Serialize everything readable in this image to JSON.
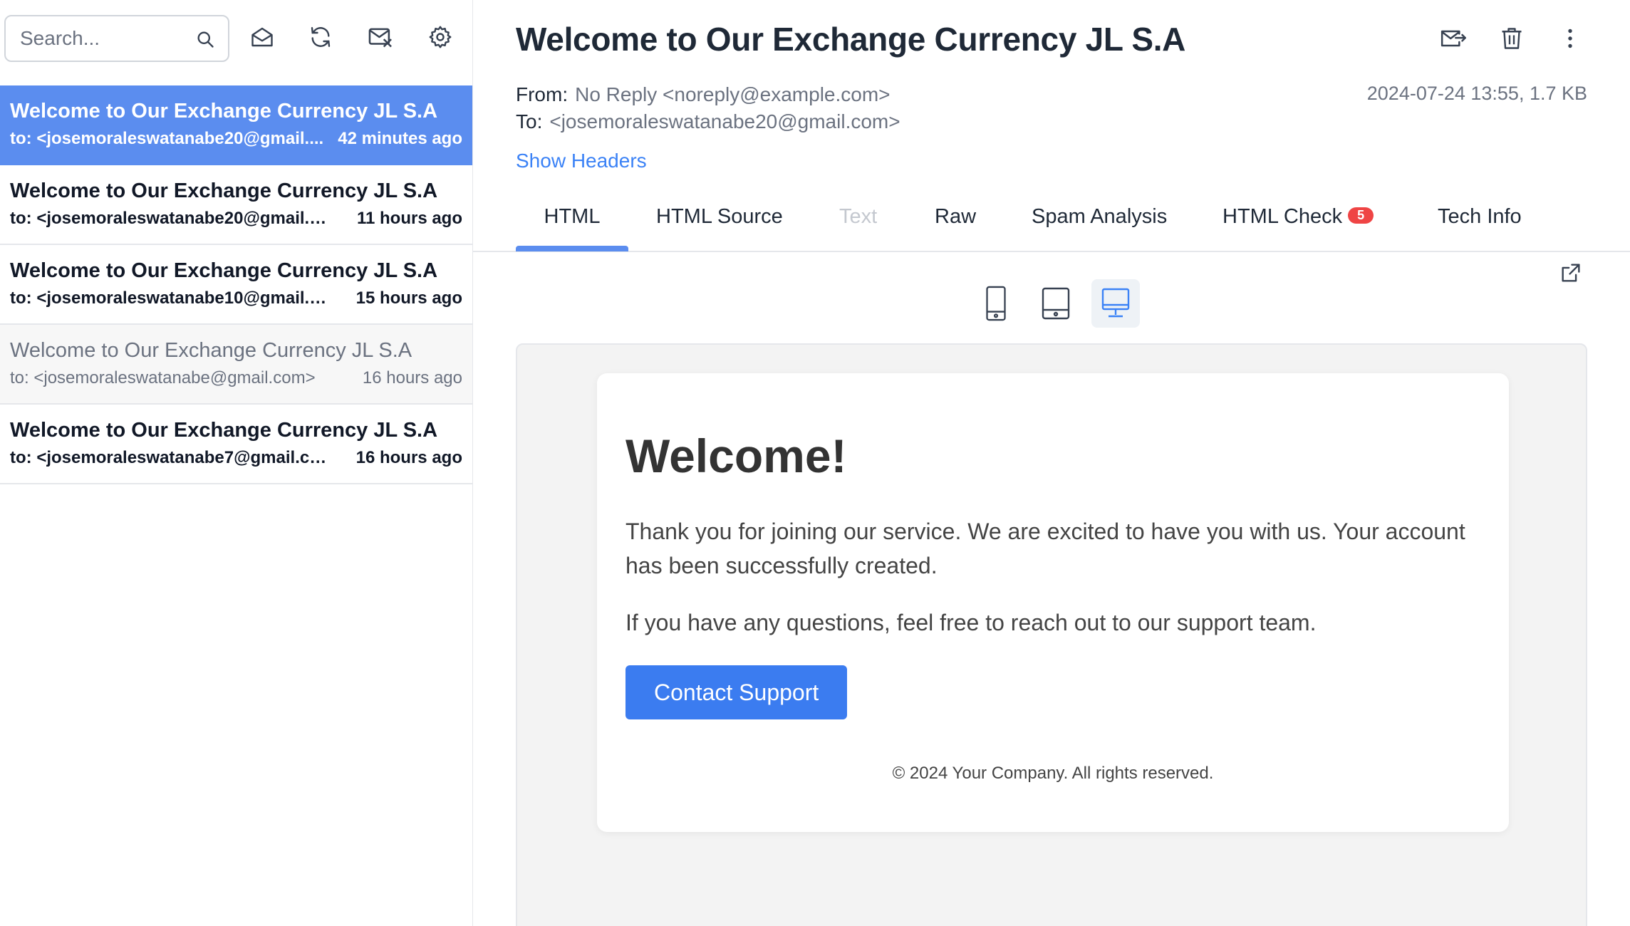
{
  "toolbar": {
    "search_placeholder": "Search..."
  },
  "messages": [
    {
      "subject": "Welcome to Our Exchange Currency JL S.A",
      "to": "to: <josemoraleswatanabe20@gmail....",
      "time": "42 minutes ago",
      "state": "active"
    },
    {
      "subject": "Welcome to Our Exchange Currency JL S.A",
      "to": "to: <josemoraleswatanabe20@gmail.co...",
      "time": "11 hours ago",
      "state": "unread"
    },
    {
      "subject": "Welcome to Our Exchange Currency JL S.A",
      "to": "to: <josemoraleswatanabe10@gmail.co...",
      "time": "15 hours ago",
      "state": "unread"
    },
    {
      "subject": "Welcome to Our Exchange Currency JL S.A",
      "to": "to: <josemoraleswatanabe@gmail.com>",
      "time": "16 hours ago",
      "state": "read"
    },
    {
      "subject": "Welcome to Our Exchange Currency JL S.A",
      "to": "to: <josemoraleswatanabe7@gmail.com>",
      "time": "16 hours ago",
      "state": "unread"
    }
  ],
  "email": {
    "title": "Welcome to Our Exchange Currency JL S.A",
    "from_label": "From:",
    "from_value": "No Reply <noreply@example.com>",
    "to_label": "To:",
    "to_value": "<josemoraleswatanabe20@gmail.com>",
    "date_size": "2024-07-24 13:55, 1.7 KB",
    "show_headers": "Show Headers"
  },
  "tabs": [
    {
      "label": "HTML",
      "state": "active"
    },
    {
      "label": "HTML Source",
      "state": "normal"
    },
    {
      "label": "Text",
      "state": "disabled"
    },
    {
      "label": "Raw",
      "state": "normal"
    },
    {
      "label": "Spam Analysis",
      "state": "normal"
    },
    {
      "label": "HTML Check",
      "state": "normal",
      "badge": "5"
    },
    {
      "label": "Tech Info",
      "state": "normal"
    }
  ],
  "preview": {
    "heading": "Welcome!",
    "paragraph1": "Thank you for joining our service. We are excited to have you with us. Your account has been successfully created.",
    "paragraph2": "If you have any questions, feel free to reach out to our support team.",
    "button": "Contact Support",
    "footer": "© 2024 Your Company. All rights reserved."
  },
  "colors": {
    "accent": "#5b8def",
    "link": "#3b82f6",
    "badge": "#ef4444",
    "button": "#3b7cf0"
  }
}
